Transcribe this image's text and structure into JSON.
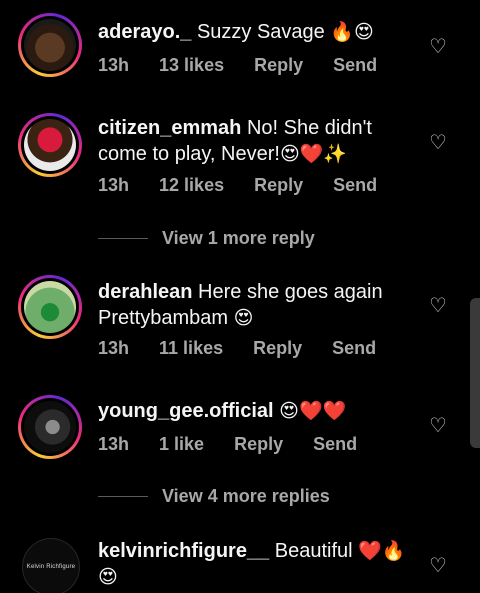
{
  "comments": [
    {
      "username": "aderayo._",
      "text": " Suzzy Savage ",
      "emoji": "🔥😍",
      "time": "13h",
      "likes": "13 likes",
      "reply": "Reply",
      "send": "Send"
    },
    {
      "username": "citizen_emmah",
      "text": " No! She didn't come to play, Never!",
      "emoji": "😍❤️✨",
      "time": "13h",
      "likes": "12 likes",
      "reply": "Reply",
      "send": "Send"
    },
    {
      "username": "derahlean",
      "text": " Here she goes again Prettybambam ",
      "emoji": "😍",
      "time": "13h",
      "likes": "11 likes",
      "reply": "Reply",
      "send": "Send"
    },
    {
      "username": "young_gee.official",
      "text": " ",
      "emoji": "😍❤️❤️",
      "time": "13h",
      "likes": "1 like",
      "reply": "Reply",
      "send": "Send"
    },
    {
      "username": "kelvinrichfigure__",
      "text": " Beautiful ",
      "emoji": "❤️🔥 😍",
      "avatar_text": "Kelvin Richfigure"
    }
  ],
  "more_replies": [
    "View 1 more reply",
    "View 4 more replies"
  ]
}
